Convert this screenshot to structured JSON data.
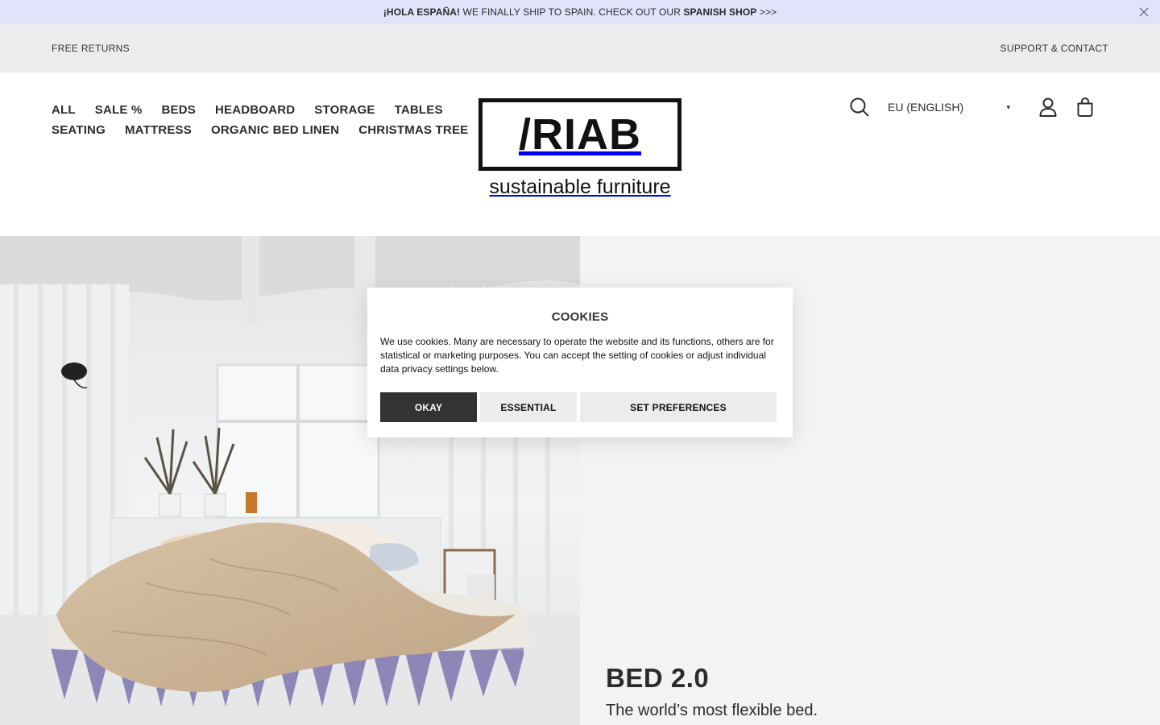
{
  "announcement": {
    "lead": "¡HOLA ESPAÑA!",
    "middle": " WE FINALLY SHIP TO SPAIN. CHECK OUT OUR ",
    "link": "SPANISH SHOP",
    "tail": " >>>"
  },
  "utility": {
    "left": "FREE RETURNS",
    "right": "SUPPORT & CONTACT"
  },
  "nav": {
    "row1": [
      "ALL",
      "SALE %",
      "BEDS",
      "HEADBOARD",
      "STORAGE",
      "TABLES"
    ],
    "row2": [
      "SEATING",
      "MATTRESS",
      "ORGANIC BED LINEN",
      "CHRISTMAS TREE"
    ]
  },
  "logo": {
    "mark": "/RIAB",
    "tagline": "sustainable furniture"
  },
  "header_tools": {
    "locale": "EU (ENGLISH)",
    "caret": "▾"
  },
  "hero": {
    "title": "BED 2.0",
    "subtitle": "The world’s most flexible bed."
  },
  "cookie": {
    "title": "COOKIES",
    "body": "We use cookies. Many are necessary to operate the website and its functions, others are for statistical or marketing purposes. You can accept the setting of cookies or adjust individual data privacy settings below.",
    "okay": "OKAY",
    "essential": "ESSENTIAL",
    "preferences": "SET PREFERENCES"
  },
  "colors": {
    "announcement_bg": "#e2e3fb",
    "utility_bg": "#ececec",
    "text": "#2b2b2b",
    "okay_button": "#333333",
    "secondary_button": "#ececec",
    "hero_right_bg": "#f3f3f3",
    "bed_frame": "#8f86b8"
  },
  "icons": [
    "close-icon",
    "search-icon",
    "account-icon",
    "shopping-bag-icon",
    "chevron-down-icon"
  ]
}
